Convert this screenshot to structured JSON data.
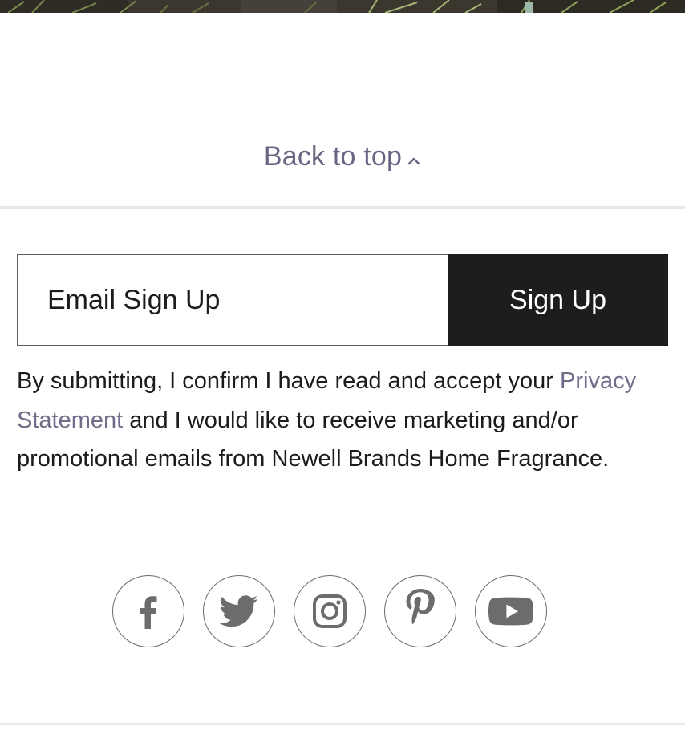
{
  "footer": {
    "back_to_top_label": "Back to top",
    "signup": {
      "input_placeholder": "Email Sign Up",
      "input_value": "",
      "button_label": "Sign Up"
    },
    "consent": {
      "text_before": "By submitting, I confirm I have read and accept your ",
      "privacy_link_label": "Privacy Statement",
      "text_after": " and I would like to receive marketing and/or promotional emails from Newell Brands Home Fragrance."
    },
    "social_icons": [
      "facebook-icon",
      "twitter-icon",
      "instagram-icon",
      "pinterest-icon",
      "youtube-icon"
    ]
  },
  "colors": {
    "link": "#686683",
    "button_bg": "#1d1d1d",
    "button_text": "#ffffff",
    "divider": "#e9e9e9",
    "icon_stroke": "#6c6c6c"
  }
}
